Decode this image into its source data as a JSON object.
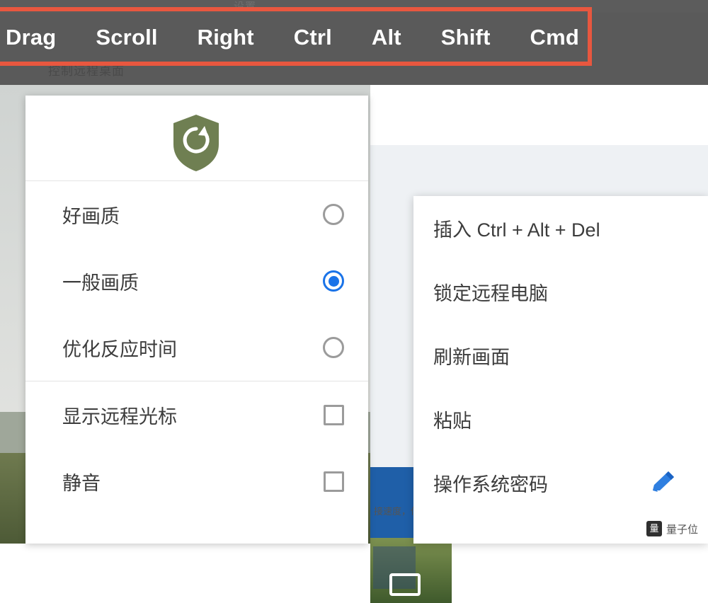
{
  "toolbar": {
    "buttons": [
      {
        "label": "Drag",
        "name": "drag-button"
      },
      {
        "label": "Scroll",
        "name": "scroll-button"
      },
      {
        "label": "Right",
        "name": "right-click-button"
      },
      {
        "label": "Ctrl",
        "name": "ctrl-button"
      },
      {
        "label": "Alt",
        "name": "alt-button"
      },
      {
        "label": "Shift",
        "name": "shift-button"
      },
      {
        "label": "Cmd",
        "name": "cmd-button"
      }
    ],
    "highlight_color": "#e8573f",
    "background_color": "#5a5a5a",
    "text_color": "#ffffff",
    "ghost_text_top": "设置",
    "ghost_text_bottom": "控制远程桌面"
  },
  "quality_menu": {
    "header_icon": "shield-refresh-icon",
    "accent_color": "#1a73e8",
    "options": [
      {
        "label": "好画质",
        "control": "radio",
        "selected": false,
        "name": "option-high-quality"
      },
      {
        "label": "一般画质",
        "control": "radio",
        "selected": true,
        "name": "option-normal-quality"
      },
      {
        "label": "优化反应时间",
        "control": "radio",
        "selected": false,
        "name": "option-optimize-latency"
      }
    ],
    "checkboxes": [
      {
        "label": "显示远程光标",
        "checked": false,
        "name": "option-show-remote-cursor"
      },
      {
        "label": "静音",
        "checked": false,
        "name": "option-mute"
      }
    ]
  },
  "context_menu": {
    "items": [
      {
        "label": "插入 Ctrl + Alt + Del",
        "name": "menu-item-send-ctrl-alt-del",
        "icon": null
      },
      {
        "label": "锁定远程电脑",
        "name": "menu-item-lock-remote-pc",
        "icon": null
      },
      {
        "label": "刷新画面",
        "name": "menu-item-refresh-screen",
        "icon": null
      },
      {
        "label": "粘贴",
        "name": "menu-item-paste",
        "icon": null
      },
      {
        "label": "操作系统密码",
        "name": "menu-item-os-password",
        "icon": "pencil-icon"
      }
    ]
  },
  "background": {
    "right_caption": "接速度，你··"
  },
  "watermark": {
    "logo_text": "量",
    "text": "量子位"
  }
}
